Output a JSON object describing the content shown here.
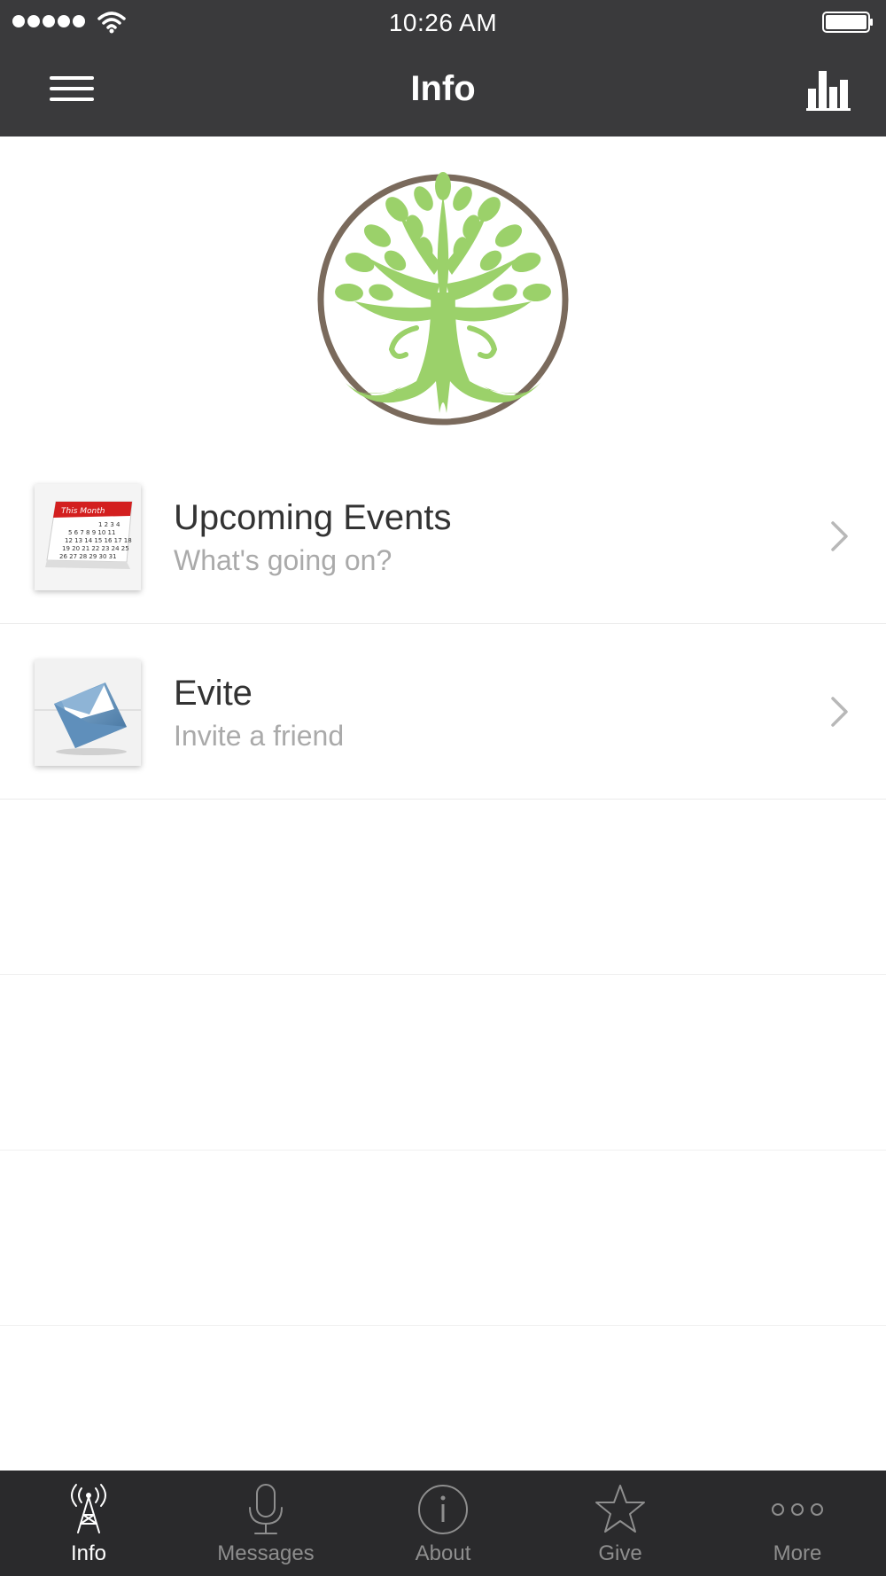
{
  "status_bar": {
    "time": "10:26 AM"
  },
  "nav": {
    "title": "Info"
  },
  "list": {
    "items": [
      {
        "title": "Upcoming Events",
        "subtitle": "What's going on?",
        "thumb_caption": "This Month"
      },
      {
        "title": "Evite",
        "subtitle": "Invite a friend"
      }
    ]
  },
  "tabs": [
    {
      "label": "Info",
      "icon": "radio-tower-icon",
      "active": true
    },
    {
      "label": "Messages",
      "icon": "microphone-icon",
      "active": false
    },
    {
      "label": "About",
      "icon": "info-circle-icon",
      "active": false
    },
    {
      "label": "Give",
      "icon": "star-icon",
      "active": false
    },
    {
      "label": "More",
      "icon": "more-dots-icon",
      "active": false
    }
  ],
  "colors": {
    "bar_bg": "#3a3a3c",
    "tab_bg": "#2a2a2c",
    "logo_green": "#9bd16a",
    "logo_ring": "#7a6a5c",
    "active_tab": "#ffffff",
    "inactive_tab": "#8e8e8e"
  }
}
